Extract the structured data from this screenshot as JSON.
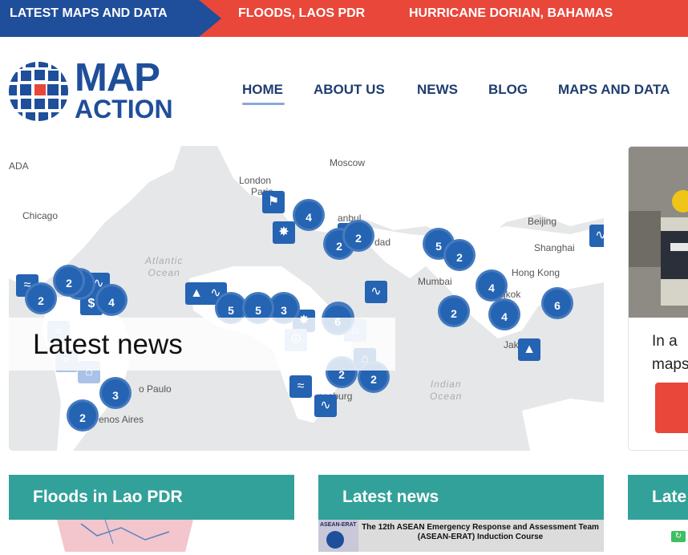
{
  "ticker": {
    "label": "LATEST MAPS AND DATA",
    "items": [
      "FLOODS, LAOS PDR",
      "HURRICANE DORIAN, BAHAMAS"
    ]
  },
  "logo": {
    "line1": "MAP",
    "line2": "ACTION"
  },
  "nav": {
    "items": [
      {
        "label": "HOME",
        "active": true
      },
      {
        "label": "ABOUT US"
      },
      {
        "label": "NEWS"
      },
      {
        "label": "BLOG"
      },
      {
        "label": "MAPS AND DATA"
      }
    ]
  },
  "map": {
    "overlay_title": "Latest news",
    "cities": [
      "Chicago",
      "London",
      "Paris",
      "Moscow",
      "Istanbul",
      "Baghdad",
      "Beijing",
      "Shanghai",
      "Mumbai",
      "Hong Kong",
      "Bangkok",
      "Jakarta",
      "São Paulo",
      "Buenos Aires",
      "Johannesburg"
    ],
    "city_fragments": {
      "istanbul": "anbul",
      "baghdad": "dad",
      "bangkok": "gkok",
      "jakarta": "Jak",
      "sao_paulo": "o Paulo",
      "buenos_aires": "enos Aires",
      "johannesburg": "nesburg",
      "canada": "ADA"
    },
    "oceans": {
      "atlantic": [
        "Atlantic",
        "Ocean"
      ],
      "indian": [
        "Indian",
        "Ocean"
      ]
    },
    "clusters": [
      "4",
      "2",
      "2",
      "5",
      "2",
      "2",
      "5",
      "4",
      "2",
      "5",
      "3",
      "5",
      "4",
      "2",
      "6",
      "4",
      "2",
      "6",
      "2",
      "2",
      "3",
      "2"
    ],
    "colors": {
      "cluster": "#2563b3",
      "land": "#ffffff",
      "water": "#e6e7e8"
    }
  },
  "right_card": {
    "text_line1": "In a",
    "text_line2": "maps"
  },
  "cards": [
    {
      "title": "Floods in Lao PDR"
    },
    {
      "title": "Latest news",
      "image_caption": "The 12th ASEAN Emergency Response and Assessment Team (ASEAN-ERAT) Induction Course",
      "badge": "ASEAN-ERAT"
    },
    {
      "title": "Late"
    }
  ],
  "colors": {
    "brand_blue": "#1f4e9a",
    "ticker_red": "#e8473a",
    "teal": "#32a19a"
  }
}
